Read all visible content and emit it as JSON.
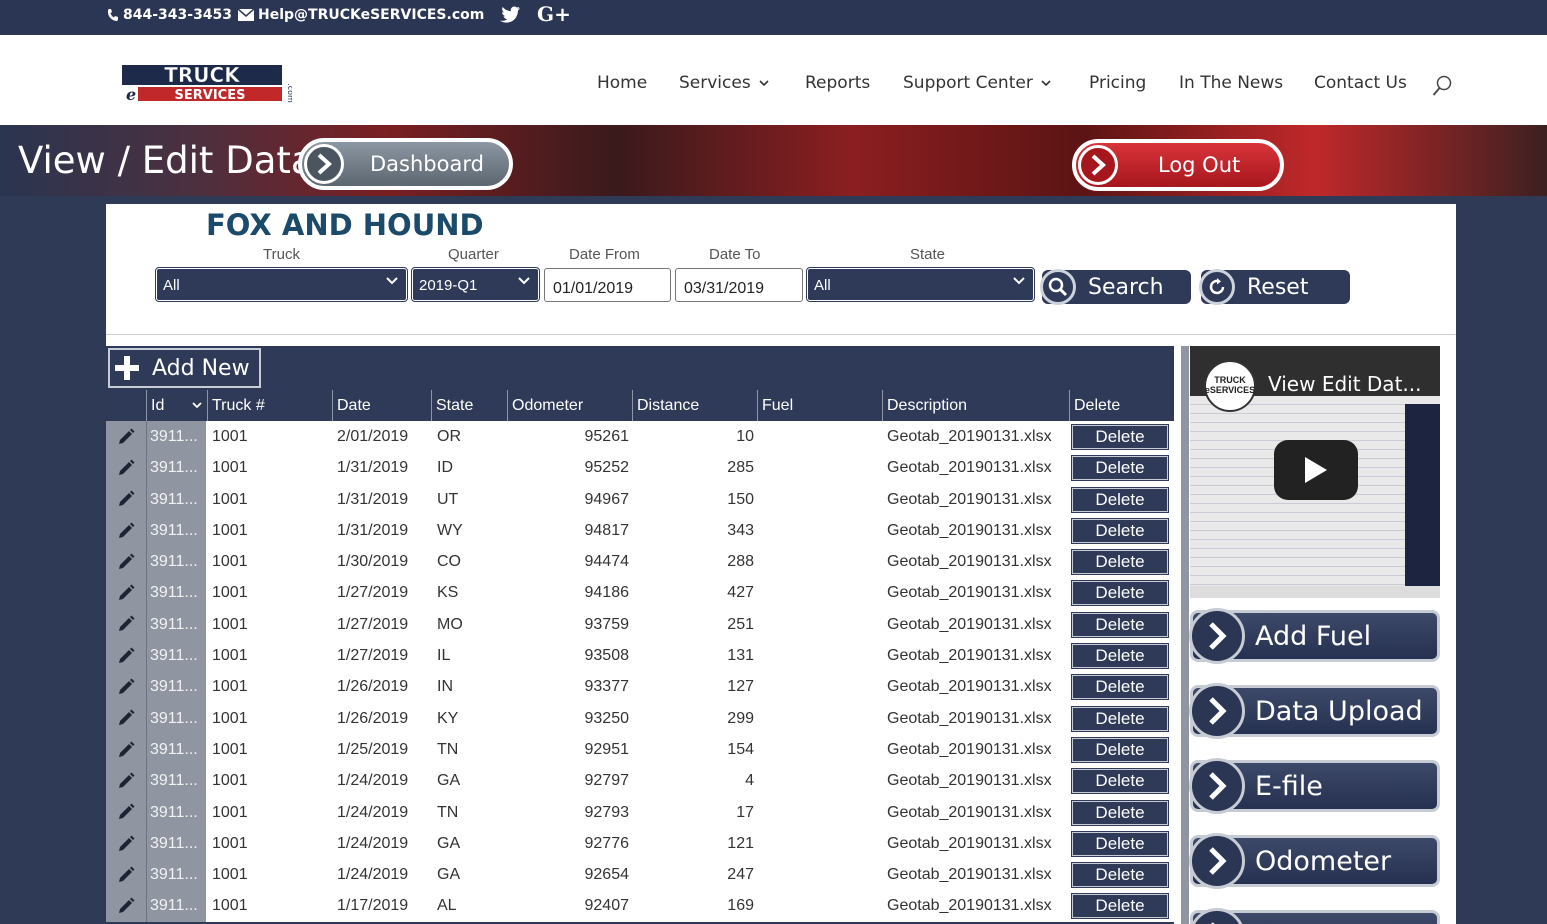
{
  "topbar": {
    "phone": "844-343-3453",
    "email": "Help@TRUCKeSERVICES.com"
  },
  "header": {
    "logo_text": "TRUCK eSERVICES .com",
    "nav": [
      {
        "label": "Home",
        "has_dropdown": false
      },
      {
        "label": "Services",
        "has_dropdown": true
      },
      {
        "label": "Reports",
        "has_dropdown": false
      },
      {
        "label": "Support Center",
        "has_dropdown": true
      },
      {
        "label": "Pricing",
        "has_dropdown": false
      },
      {
        "label": "In The News",
        "has_dropdown": false
      },
      {
        "label": "Contact Us",
        "has_dropdown": false
      }
    ]
  },
  "banner": {
    "title": "View / Edit Data",
    "dashboard_label": "Dashboard",
    "logout_label": "Log Out"
  },
  "filters": {
    "company": "FOX AND HOUND",
    "truck_label": "Truck",
    "truck_value": "All",
    "quarter_label": "Quarter",
    "quarter_value": "2019-Q1",
    "date_from_label": "Date From",
    "date_from_value": "01/01/2019",
    "date_to_label": "Date To",
    "date_to_value": "03/31/2019",
    "state_label": "State",
    "state_value": "All",
    "search_label": "Search",
    "reset_label": "Reset"
  },
  "grid": {
    "add_new_label": "Add New",
    "columns": [
      "Id",
      "Truck #",
      "Date",
      "State",
      "Odometer",
      "Distance",
      "Fuel",
      "Description",
      "Delete"
    ],
    "delete_label": "Delete",
    "rows": [
      {
        "id": "3911...",
        "truck": "1001",
        "date": "2/01/2019",
        "state": "OR",
        "odometer": "95261",
        "distance": "10",
        "fuel": "",
        "description": "Geotab_20190131.xlsx"
      },
      {
        "id": "3911...",
        "truck": "1001",
        "date": "1/31/2019",
        "state": "ID",
        "odometer": "95252",
        "distance": "285",
        "fuel": "",
        "description": "Geotab_20190131.xlsx"
      },
      {
        "id": "3911...",
        "truck": "1001",
        "date": "1/31/2019",
        "state": "UT",
        "odometer": "94967",
        "distance": "150",
        "fuel": "",
        "description": "Geotab_20190131.xlsx"
      },
      {
        "id": "3911...",
        "truck": "1001",
        "date": "1/31/2019",
        "state": "WY",
        "odometer": "94817",
        "distance": "343",
        "fuel": "",
        "description": "Geotab_20190131.xlsx"
      },
      {
        "id": "3911...",
        "truck": "1001",
        "date": "1/30/2019",
        "state": "CO",
        "odometer": "94474",
        "distance": "288",
        "fuel": "",
        "description": "Geotab_20190131.xlsx"
      },
      {
        "id": "3911...",
        "truck": "1001",
        "date": "1/27/2019",
        "state": "KS",
        "odometer": "94186",
        "distance": "427",
        "fuel": "",
        "description": "Geotab_20190131.xlsx"
      },
      {
        "id": "3911...",
        "truck": "1001",
        "date": "1/27/2019",
        "state": "MO",
        "odometer": "93759",
        "distance": "251",
        "fuel": "",
        "description": "Geotab_20190131.xlsx"
      },
      {
        "id": "3911...",
        "truck": "1001",
        "date": "1/27/2019",
        "state": "IL",
        "odometer": "93508",
        "distance": "131",
        "fuel": "",
        "description": "Geotab_20190131.xlsx"
      },
      {
        "id": "3911...",
        "truck": "1001",
        "date": "1/26/2019",
        "state": "IN",
        "odometer": "93377",
        "distance": "127",
        "fuel": "",
        "description": "Geotab_20190131.xlsx"
      },
      {
        "id": "3911...",
        "truck": "1001",
        "date": "1/26/2019",
        "state": "KY",
        "odometer": "93250",
        "distance": "299",
        "fuel": "",
        "description": "Geotab_20190131.xlsx"
      },
      {
        "id": "3911...",
        "truck": "1001",
        "date": "1/25/2019",
        "state": "TN",
        "odometer": "92951",
        "distance": "154",
        "fuel": "",
        "description": "Geotab_20190131.xlsx"
      },
      {
        "id": "3911...",
        "truck": "1001",
        "date": "1/24/2019",
        "state": "GA",
        "odometer": "92797",
        "distance": "4",
        "fuel": "",
        "description": "Geotab_20190131.xlsx"
      },
      {
        "id": "3911...",
        "truck": "1001",
        "date": "1/24/2019",
        "state": "TN",
        "odometer": "92793",
        "distance": "17",
        "fuel": "",
        "description": "Geotab_20190131.xlsx"
      },
      {
        "id": "3911...",
        "truck": "1001",
        "date": "1/24/2019",
        "state": "GA",
        "odometer": "92776",
        "distance": "121",
        "fuel": "",
        "description": "Geotab_20190131.xlsx"
      },
      {
        "id": "3911...",
        "truck": "1001",
        "date": "1/24/2019",
        "state": "GA",
        "odometer": "92654",
        "distance": "247",
        "fuel": "",
        "description": "Geotab_20190131.xlsx"
      },
      {
        "id": "3911...",
        "truck": "1001",
        "date": "1/17/2019",
        "state": "AL",
        "odometer": "92407",
        "distance": "169",
        "fuel": "",
        "description": "Geotab_20190131.xlsx"
      }
    ]
  },
  "sidebar": {
    "video_title": "View Edit Dat...",
    "video_channel_text": "TRUCK eSERVICES",
    "buttons": [
      "Add Fuel",
      "Data Upload",
      "E-file",
      "Odometer"
    ]
  },
  "colors": {
    "navy": "#2e3a58",
    "title_blue": "#1b4a6b",
    "logout_red": "#c0282a"
  }
}
